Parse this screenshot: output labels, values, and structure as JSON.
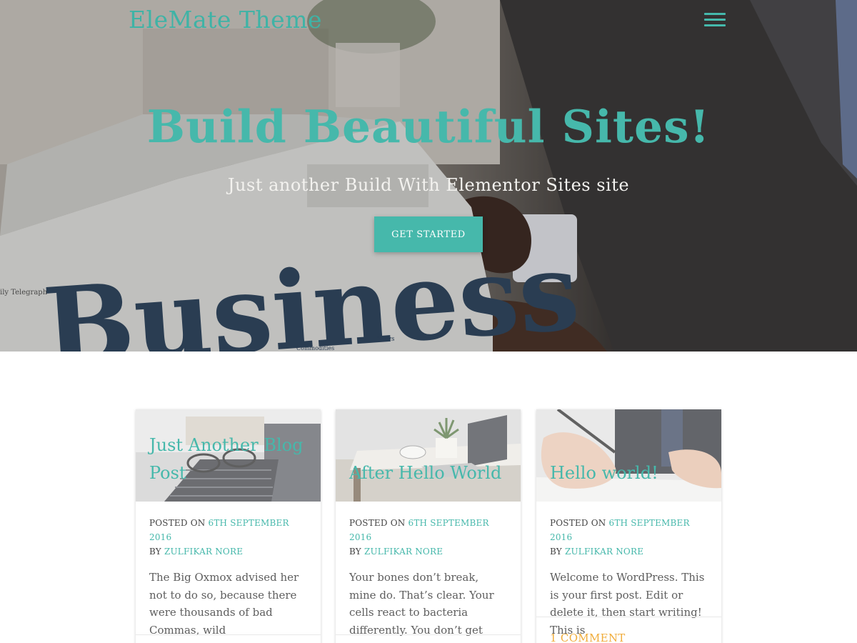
{
  "header": {
    "site_title": "EleMate Theme",
    "menu_icon": "hamburger-menu-icon"
  },
  "hero": {
    "heading": "Build Beautiful Sites!",
    "subheading": "Just another Build With Elementor Sites site",
    "cta_label": "GET STARTED",
    "newspaper_word": "Business",
    "newspaper_bits": [
      "ily Telegraph",
      "News",
      "Commodities"
    ]
  },
  "posts": [
    {
      "title": "Just Another Blog Post",
      "posted_on_label": "POSTED ON",
      "date": "6TH SEPTEMBER 2016",
      "by_label": "BY",
      "author": "ZULFIKAR NORE",
      "excerpt": "The Big Oxmox advised her not to do so, because there were thousands of bad Commas, wild"
    },
    {
      "title": "After Hello World",
      "posted_on_label": "POSTED ON",
      "date": "6TH SEPTEMBER 2016",
      "by_label": "BY",
      "author": "ZULFIKAR NORE",
      "excerpt": "Your bones don’t break, mine do. That’s clear. Your cells react to bacteria differently. You don’t get"
    },
    {
      "title": "Hello world!",
      "posted_on_label": "POSTED ON",
      "date": "6TH SEPTEMBER 2016",
      "by_label": "BY",
      "author": "ZULFIKAR NORE",
      "excerpt": "Welcome to WordPress. This is your first post. Edit or delete it, then start writing! This is",
      "comments": "1 COMMENT"
    }
  ],
  "colors": {
    "accent": "#46b8ab",
    "comment_link": "#f0ac3a",
    "text": "#5e5e5e"
  }
}
